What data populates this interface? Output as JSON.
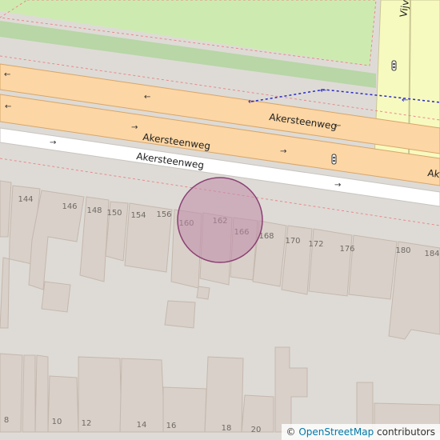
{
  "map": {
    "streets": {
      "upper_label": "Akersteenweg",
      "middle_label": "Akersteenweg",
      "lower_label": "Akersteenweg",
      "edge_label_right": "Ak",
      "vertical_label": "Vijve"
    },
    "house_numbers": [
      "144",
      "146",
      "148",
      "150",
      "154",
      "156",
      "160",
      "162",
      "166",
      "168",
      "170",
      "172",
      "176",
      "180",
      "184",
      "8",
      "10",
      "12",
      "14",
      "16",
      "18",
      "20"
    ],
    "marker": {
      "fill": "#c08aa8",
      "stroke": "#8b3f73",
      "opacity": 0.55
    },
    "colors": {
      "road_primary": "#fcd6a4",
      "road_secondary": "#f7fabf",
      "park": "#cdebb0",
      "building": "#d9d0c9",
      "landuse": "#dedbd6",
      "service_road": "#ffffff"
    }
  },
  "attribution": {
    "symbol": "©",
    "link_text": "OpenStreetMap",
    "suffix": "contributors"
  }
}
